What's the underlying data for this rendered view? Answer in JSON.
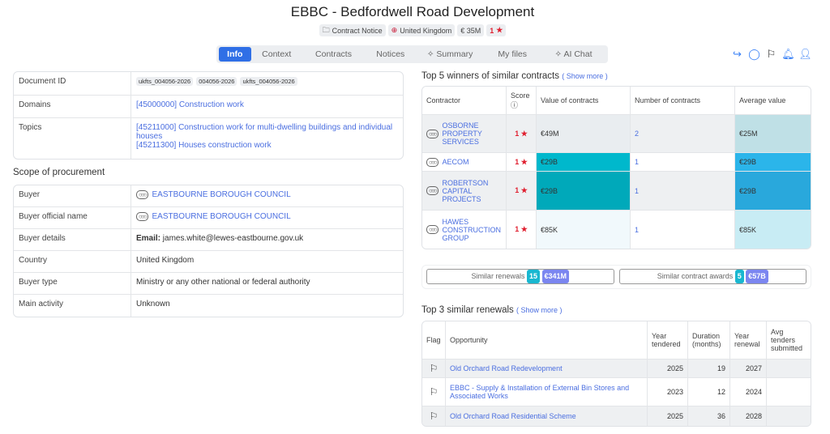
{
  "header": {
    "title": "EBBC - Bedfordwell Road Development",
    "badges": {
      "type": "Contract Notice",
      "country": "United Kingdom",
      "value": "€ 35M",
      "score": "1"
    }
  },
  "tabs": [
    "Info",
    "Context",
    "Contracts",
    "Notices",
    "Summary",
    "My files",
    "AI Chat"
  ],
  "actions": [
    "share-icon",
    "comment-icon",
    "flag-icon",
    "bell-icon",
    "add-user-icon"
  ],
  "info": {
    "document_id_label": "Document ID",
    "document_ids": [
      "ukfts_004056-2026",
      "004056-2026",
      "ukfts_004056-2026"
    ],
    "domains_label": "Domains",
    "domain": "[45000000] Construction work",
    "topics_label": "Topics",
    "topics": [
      "[45211000] Construction work for multi-dwelling buildings and individual houses",
      "[45211300] Houses construction work"
    ]
  },
  "scope": {
    "title": "Scope of procurement",
    "buyer_label": "Buyer",
    "buyer": "EASTBOURNE BOROUGH COUNCIL",
    "official_label": "Buyer official name",
    "official": "EASTBOURNE BOROUGH COUNCIL",
    "details_label": "Buyer details",
    "email_label": "Email:",
    "email": "james.white@lewes-eastbourne.gov.uk",
    "country_label": "Country",
    "country": "United Kingdom",
    "type_label": "Buyer type",
    "type": "Ministry or any other national or federal authority",
    "activity_label": "Main activity",
    "activity": "Unknown"
  },
  "winners": {
    "title": "Top 5 winners of similar contracts",
    "show_more": "( Show more )",
    "headers": [
      "Contractor",
      "Score",
      "Value of contracts",
      "Number of contracts",
      "Average value"
    ],
    "rows": [
      {
        "name": "OSBORNE PROPERTY SERVICES",
        "score": "1",
        "value": "€49M",
        "count": "2",
        "avg": "€25M"
      },
      {
        "name": "AECOM",
        "score": "1",
        "value": "€29B",
        "count": "1",
        "avg": "€29B"
      },
      {
        "name": "ROBERTSON CAPITAL PROJECTS",
        "score": "1",
        "value": "€29B",
        "count": "1",
        "avg": "€29B"
      },
      {
        "name": "HAWES CONSTRUCTION GROUP",
        "score": "1",
        "value": "€85K",
        "count": "1",
        "avg": "€85K"
      }
    ]
  },
  "similar": {
    "renewals_label": "Similar renewals",
    "renewals_count": "15",
    "renewals_value": "€341M",
    "awards_label": "Similar contract awards",
    "awards_count": "5",
    "awards_value": "€57B"
  },
  "renewals": {
    "title": "Top 3 similar renewals",
    "show_more": "( Show more )",
    "headers": [
      "Flag",
      "Opportunity",
      "Year tendered",
      "Duration (months)",
      "Year renewal",
      "Avg tenders submitted"
    ],
    "rows": [
      {
        "name": "Old Orchard Road Redevelopment",
        "year": "2025",
        "duration": "19",
        "renewal": "2027"
      },
      {
        "name": "EBBC - Supply & Installation of External Bin Stores and Associated Works",
        "year": "2023",
        "duration": "12",
        "renewal": "2024"
      },
      {
        "name": "Old Orchard Road Residential Scheme",
        "year": "2025",
        "duration": "36",
        "renewal": "2028"
      }
    ]
  }
}
